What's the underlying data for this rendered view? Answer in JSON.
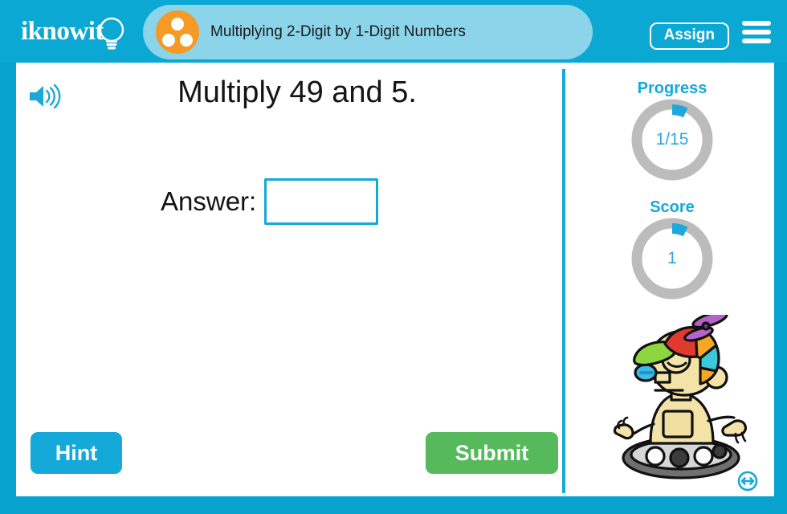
{
  "header": {
    "logo_text": "iknowit",
    "logo_icon": "lightbulb-icon",
    "topic_icon": "three-dots-circle-icon",
    "topic_title": "Multiplying 2-Digit by 1-Digit Numbers",
    "assign_label": "Assign",
    "menu_icon": "hamburger-menu-icon"
  },
  "question": {
    "audio_icon": "speaker-icon",
    "text": "Multiply 49 and 5.",
    "answer_label": "Answer:",
    "answer_value": "",
    "answer_placeholder": ""
  },
  "actions": {
    "hint_label": "Hint",
    "submit_label": "Submit"
  },
  "sidebar": {
    "progress_label": "Progress",
    "progress_value": "1/15",
    "progress_current": 1,
    "progress_total": 15,
    "score_label": "Score",
    "score_value": "1",
    "mascot_name": "robot-mascot",
    "resize_icon": "resize-horizontal-icon"
  },
  "colors": {
    "frame_cyan": "#08a3cf",
    "header_cyan": "#0ca8d4",
    "pill_blue": "#8bd4ea",
    "accent_cyan": "#14a9d8",
    "topic_orange": "#f59a24",
    "submit_green": "#56b95b",
    "gauge_track": "#bcbcbc",
    "gauge_fill": "#1fa8dd"
  }
}
